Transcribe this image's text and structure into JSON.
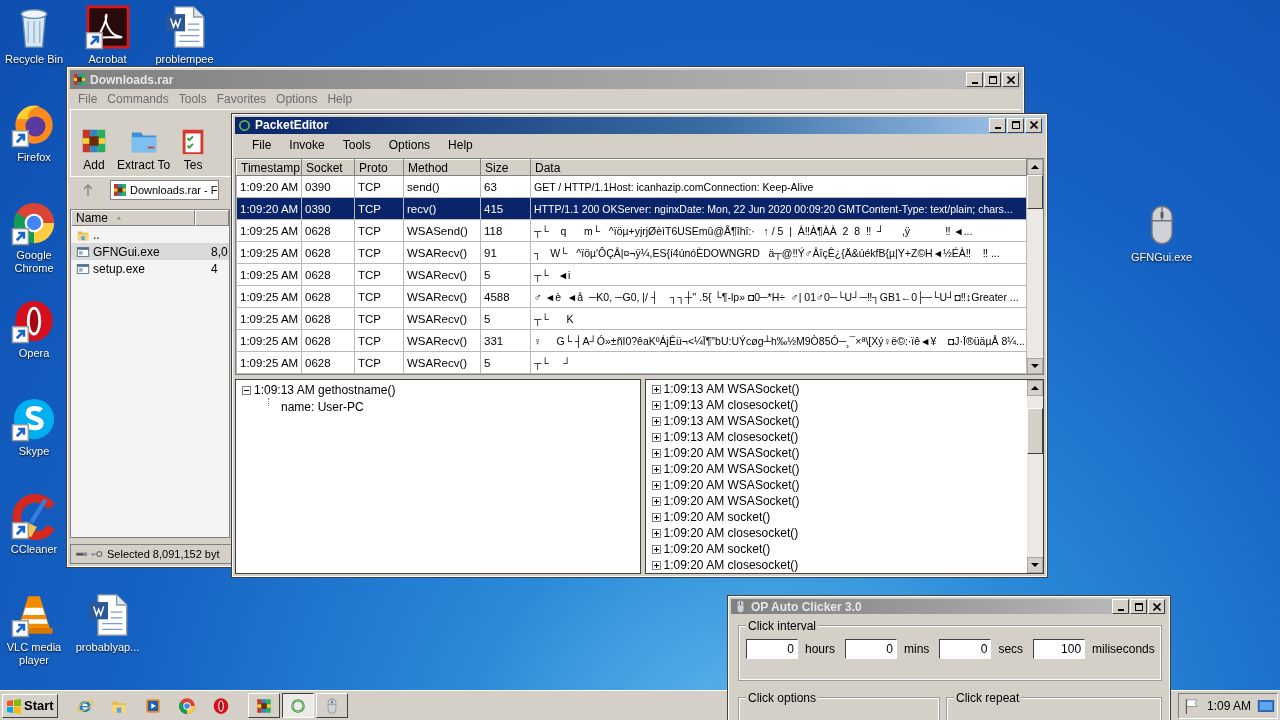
{
  "desktop_icons": [
    {
      "label": "Recycle Bin",
      "kind": "recycle",
      "shortcut": false
    },
    {
      "label": "Acrobat",
      "kind": "acrobat",
      "shortcut": true
    },
    {
      "label": "problempee",
      "kind": "word",
      "shortcut": false
    },
    {
      "label": "Firefox",
      "kind": "firefox",
      "shortcut": true
    },
    {
      "label": "Google Chrome",
      "kind": "chrome",
      "shortcut": true
    },
    {
      "label": "Opera",
      "kind": "opera",
      "shortcut": true
    },
    {
      "label": "Skype",
      "kind": "skype",
      "shortcut": true
    },
    {
      "label": "CCleaner",
      "kind": "ccleaner",
      "shortcut": true
    },
    {
      "label": "VLC media player",
      "kind": "vlc",
      "shortcut": true
    },
    {
      "label": "probablyap...",
      "kind": "word",
      "shortcut": false
    },
    {
      "label": "GFNGui.exe",
      "kind": "mouse",
      "shortcut": false
    }
  ],
  "winrar": {
    "title": "Downloads.rar",
    "menu": [
      "File",
      "Commands",
      "Tools",
      "Favorites",
      "Options",
      "Help"
    ],
    "toolbar": [
      {
        "label": "Add",
        "kind": "archive"
      },
      {
        "label": "Extract To",
        "kind": "folder"
      },
      {
        "label": "Tes",
        "kind": "test"
      }
    ],
    "address": "Downloads.rar - F",
    "column": "Name",
    "files": [
      {
        "name": "..",
        "kind": "folder",
        "selected": false
      },
      {
        "name": "GFNGui.exe",
        "size": "8,0",
        "kind": "exe",
        "selected": true
      },
      {
        "name": "setup.exe",
        "size": "4",
        "kind": "exe",
        "selected": false
      }
    ],
    "status": "Selected 8,091,152 byt"
  },
  "packet_editor": {
    "title": "PacketEditor",
    "menu": [
      "File",
      "Invoke",
      "Tools",
      "Options",
      "Help"
    ],
    "columns": [
      "Timestamp",
      "Socket",
      "Proto",
      "Method",
      "Size",
      "Data"
    ],
    "rows": [
      {
        "cells": [
          "1:09:20 AM",
          "0390",
          "TCP",
          "send()",
          "63",
          "GET / HTTP/1.1Host: icanhazip.comConnection: Keep-Alive"
        ],
        "selected": false
      },
      {
        "cells": [
          "1:09:20 AM",
          "0390",
          "TCP",
          "recv()",
          "415",
          "HTTP/1.1 200 OKServer: nginxDate: Mon, 22 Jun 2020 00:09:20 GMTContent-Type: text/plain; chars..."
        ],
        "selected": true
      },
      {
        "cells": [
          "1:09:25 AM",
          "0628",
          "TCP",
          "WSASend()",
          "118",
          "┬└    q      m└   ^ïöµ+yjrjØèìT6USEmû@Å¶îhî:·   ↑ / 5  |  À‼À¶ÀÀ  2  8  ‼  ┘      ,ÿ            ‼ ◄..."
        ],
        "selected": false
      },
      {
        "cells": [
          "1:09:25 AM",
          "0628",
          "TCP",
          "WSARecv()",
          "91",
          "┐   W└   ^ïöµ'ÔÇÂ|¤¬ÿ¼,ES{í4únóÈDOWNGRD   ä┬@‼Ý♂ÂîçÊ¿{Ä&úékfB{µ|Y+Z©H◄½ÉÀ‼    ‼ ..."
        ],
        "selected": false
      },
      {
        "cells": [
          "1:09:25 AM",
          "0628",
          "TCP",
          "WSARecv()",
          "5",
          "┬└   ◄i"
        ],
        "selected": false
      },
      {
        "cells": [
          "1:09:25 AM",
          "0628",
          "TCP",
          "WSARecv()",
          "4588",
          "♂ ◄è  ◄å  ─K0, ─G0, |/ ┤    ┐┐┼'' .5{ └¶-lp» ◘0─*H÷  ♂| 01♂0─└U┘─‼┐GB1←0├─└U┘◘‼↕Greater ..."
        ],
        "selected": false
      },
      {
        "cells": [
          "1:09:25 AM",
          "0628",
          "TCP",
          "WSARecv()",
          "5",
          "┬└      K"
        ],
        "selected": false
      },
      {
        "cells": [
          "1:09:25 AM",
          "0628",
          "TCP",
          "WSARecv()",
          "331",
          "♀     G└ ┤A┘Ó»±ñI0?êaKºÁjÊü¬<¼Ï¶\"bU:UÝcøg┴h‰½M9Ò85Ó─¸¯×ª\\[Xý♀ë©:·ïê◄¥    ◘J·Ï®üäµÅ 8¼..."
        ],
        "selected": false
      },
      {
        "cells": [
          "1:09:25 AM",
          "0628",
          "TCP",
          "WSARecv()",
          "5",
          "┬└     ┘"
        ],
        "selected": false
      }
    ],
    "left_tree": [
      {
        "label": "1:09:13 AM gethostname()",
        "expanded": true,
        "children": [
          {
            "label": "name: User-PC"
          }
        ]
      }
    ],
    "right_tree": [
      {
        "label": "1:09:13 AM WSASocket()",
        "expanded": false
      },
      {
        "label": "1:09:13 AM closesocket()",
        "expanded": false
      },
      {
        "label": "1:09:13 AM WSASocket()",
        "expanded": false
      },
      {
        "label": "1:09:13 AM closesocket()",
        "expanded": false
      },
      {
        "label": "1:09:20 AM WSASocket()",
        "expanded": false
      },
      {
        "label": "1:09:20 AM WSASocket()",
        "expanded": false
      },
      {
        "label": "1:09:20 AM WSASocket()",
        "expanded": false
      },
      {
        "label": "1:09:20 AM WSASocket()",
        "expanded": false
      },
      {
        "label": "1:09:20 AM socket()",
        "expanded": false
      },
      {
        "label": "1:09:20 AM closesocket()",
        "expanded": false
      },
      {
        "label": "1:09:20 AM socket()",
        "expanded": false
      },
      {
        "label": "1:09:20 AM closesocket()",
        "expanded": false
      }
    ]
  },
  "auto_clicker": {
    "title": "OP Auto Clicker 3.0",
    "groups": [
      {
        "label": "Click interval",
        "fields": [
          {
            "value": "0",
            "unit": "hours"
          },
          {
            "value": "0",
            "unit": "mins"
          },
          {
            "value": "0",
            "unit": "secs"
          },
          {
            "value": "100",
            "unit": "miliseconds"
          }
        ]
      },
      {
        "label": "Click options"
      },
      {
        "label": "Click repeat"
      }
    ]
  },
  "taskbar": {
    "start": "Start",
    "quick_launch": [
      {
        "kind": "ie"
      },
      {
        "kind": "explorer"
      },
      {
        "kind": "media"
      },
      {
        "kind": "chrome"
      },
      {
        "kind": "opera"
      }
    ],
    "tasks": [
      {
        "kind": "archive",
        "selected": false
      },
      {
        "kind": "packet",
        "selected": true
      },
      {
        "kind": "mouse",
        "selected": false
      }
    ],
    "clock": "1:09 AM"
  }
}
